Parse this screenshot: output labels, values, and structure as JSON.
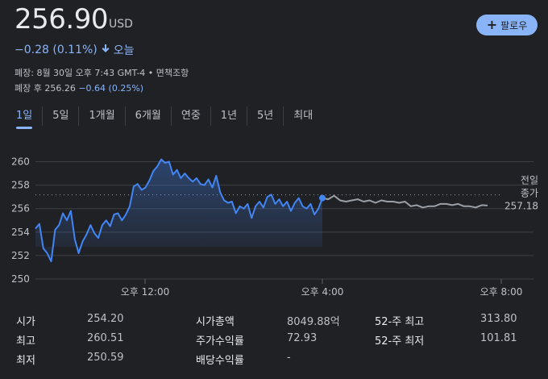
{
  "header": {
    "price": "256.90",
    "currency": "USD",
    "follow_label": "팔로우",
    "change": "−0.28 (0.11%)",
    "change_period": "오늘",
    "close_info": "폐장: 8월 30일 오후 7:43 GMT-4 • 면책조항",
    "after_hours_label": "폐장 후 256.26",
    "after_hours_change": "−0.64 (0.25%)"
  },
  "tabs": [
    "1일",
    "5일",
    "1개월",
    "6개월",
    "연중",
    "1년",
    "5년",
    "최대"
  ],
  "active_tab": 0,
  "chart_data": {
    "type": "line",
    "y_ticks": [
      "260",
      "258",
      "256",
      "254",
      "252",
      "250"
    ],
    "ylim": [
      250,
      261
    ],
    "x_ticks": [
      {
        "label": "오후 12:00",
        "t": 12.0
      },
      {
        "label": "오후 4:00",
        "t": 16.0
      },
      {
        "label": "오후 8:00",
        "t": 20.0
      }
    ],
    "xlim": [
      9.5,
      20.0
    ],
    "previous_close": 257.18,
    "previous_close_label": [
      "전일",
      "종가",
      "257.18"
    ],
    "series": [
      {
        "session": "regular",
        "color": "#4285f4",
        "points": [
          [
            9.5,
            254.3
          ],
          [
            9.6,
            254.7
          ],
          [
            9.7,
            252.6
          ],
          [
            9.8,
            252.2
          ],
          [
            9.9,
            251.5
          ],
          [
            10.0,
            254.2
          ],
          [
            10.1,
            254.6
          ],
          [
            10.2,
            255.6
          ],
          [
            10.3,
            255.0
          ],
          [
            10.4,
            255.8
          ],
          [
            10.5,
            253.4
          ],
          [
            10.6,
            252.2
          ],
          [
            10.7,
            253.2
          ],
          [
            10.8,
            253.8
          ],
          [
            10.9,
            254.6
          ],
          [
            11.0,
            253.9
          ],
          [
            11.1,
            253.5
          ],
          [
            11.2,
            254.6
          ],
          [
            11.3,
            255.0
          ],
          [
            11.4,
            254.5
          ],
          [
            11.5,
            255.5
          ],
          [
            11.6,
            255.6
          ],
          [
            11.7,
            255.0
          ],
          [
            11.8,
            255.5
          ],
          [
            11.9,
            256.2
          ],
          [
            12.0,
            257.9
          ],
          [
            12.1,
            258.1
          ],
          [
            12.2,
            257.6
          ],
          [
            12.3,
            257.8
          ],
          [
            12.4,
            258.4
          ],
          [
            12.5,
            259.2
          ],
          [
            12.6,
            259.6
          ],
          [
            12.7,
            260.2
          ],
          [
            12.8,
            259.9
          ],
          [
            12.9,
            260.0
          ],
          [
            13.0,
            258.9
          ],
          [
            13.1,
            259.3
          ],
          [
            13.2,
            258.6
          ],
          [
            13.3,
            259.0
          ],
          [
            13.4,
            258.6
          ],
          [
            13.5,
            258.3
          ],
          [
            13.6,
            258.6
          ],
          [
            13.7,
            258.1
          ],
          [
            13.8,
            258.0
          ],
          [
            13.9,
            258.5
          ],
          [
            14.0,
            257.8
          ],
          [
            14.1,
            258.8
          ],
          [
            14.2,
            257.4
          ],
          [
            14.3,
            256.7
          ],
          [
            14.4,
            256.5
          ],
          [
            14.5,
            256.6
          ],
          [
            14.6,
            255.6
          ],
          [
            14.7,
            256.2
          ],
          [
            14.8,
            256.0
          ],
          [
            14.9,
            256.4
          ],
          [
            15.0,
            255.2
          ],
          [
            15.1,
            256.2
          ],
          [
            15.2,
            256.6
          ],
          [
            15.3,
            256.1
          ],
          [
            15.4,
            257.0
          ],
          [
            15.5,
            257.2
          ],
          [
            15.6,
            256.4
          ],
          [
            15.7,
            256.8
          ],
          [
            15.8,
            256.2
          ],
          [
            15.9,
            256.6
          ],
          [
            16.0,
            255.8
          ],
          [
            16.1,
            256.5
          ],
          [
            16.2,
            256.9
          ],
          [
            16.3,
            256.2
          ],
          [
            16.4,
            256.0
          ],
          [
            16.5,
            256.4
          ],
          [
            16.6,
            255.5
          ],
          [
            16.7,
            256.0
          ],
          [
            16.8,
            256.9
          ]
        ]
      },
      {
        "session": "after-hours",
        "color": "#9aa0a6",
        "points": [
          [
            16.8,
            256.9
          ],
          [
            17.0,
            256.8
          ],
          [
            17.2,
            257.1
          ],
          [
            17.4,
            256.7
          ],
          [
            17.6,
            256.6
          ],
          [
            17.8,
            256.7
          ],
          [
            18.0,
            256.8
          ],
          [
            18.2,
            256.6
          ],
          [
            18.4,
            256.7
          ],
          [
            18.6,
            256.5
          ],
          [
            18.8,
            256.7
          ],
          [
            19.0,
            256.6
          ],
          [
            19.2,
            256.6
          ],
          [
            19.4,
            256.5
          ],
          [
            19.6,
            256.6
          ],
          [
            19.8,
            256.2
          ],
          [
            20.0,
            256.3
          ],
          [
            20.2,
            256.1
          ],
          [
            20.4,
            256.2
          ],
          [
            20.6,
            256.2
          ],
          [
            20.8,
            256.4
          ],
          [
            21.0,
            256.4
          ],
          [
            21.2,
            256.3
          ],
          [
            21.4,
            256.4
          ],
          [
            21.6,
            256.2
          ],
          [
            21.8,
            256.2
          ],
          [
            22.0,
            256.1
          ],
          [
            22.2,
            256.3
          ],
          [
            22.4,
            256.26
          ]
        ]
      }
    ]
  },
  "stats": [
    [
      {
        "label": "시가",
        "value": "254.20"
      },
      {
        "label": "시가총액",
        "value": "8049.88억"
      },
      {
        "label": "52-주 최고",
        "value": "313.80"
      }
    ],
    [
      {
        "label": "최고",
        "value": "260.51"
      },
      {
        "label": "주가수익률",
        "value": "72.93"
      },
      {
        "label": "52-주 최저",
        "value": "101.81"
      }
    ],
    [
      {
        "label": "최저",
        "value": "250.59"
      },
      {
        "label": "배당수익률",
        "value": "-"
      }
    ]
  ]
}
